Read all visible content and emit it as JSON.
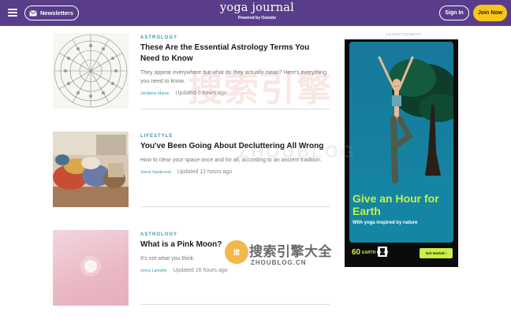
{
  "header": {
    "newsletter_label": "Newsletters",
    "logo_text": "yoga journal",
    "logo_sub": "Powered by Outside",
    "signin_label": "Sign In",
    "join_label": "Join Now",
    "bg_color": "#5a3d8a",
    "join_color": "#f7c716"
  },
  "articles": [
    {
      "category": "ASTROLOGY",
      "title": "These Are the Essential Astrology Terms You Need to Know",
      "dek": "They appear everywhere but what do they actually mean? Here's everything you need to know.",
      "author": "Jordanne Maree",
      "time": "Updated 6 hours ago"
    },
    {
      "category": "LIFESTYLE",
      "title": "You've Been Going About Decluttering All Wrong",
      "dek": "How to clear your space once and for all, according to an ancient tradition.",
      "author": "Sierra Vandervort",
      "time": "Updated 12 hours ago"
    },
    {
      "category": "ASTROLOGY",
      "title": "What is a Pink Moon?",
      "dek": "It's not what you think.",
      "author": "Jenny Lamielle",
      "time": "Updated 16 hours ago"
    }
  ],
  "ad": {
    "label": "ADVERTISEMENT",
    "headline": "Give an Hour for Earth",
    "subtext": "With yoga inspired by nature",
    "logo_number": "60",
    "logo_text": "EARTH HOUR",
    "cta": "Get started ›",
    "accent": "#c8f049"
  },
  "watermark": {
    "big_text": "搜索引擎",
    "big_sub": "ZHOUBLOG",
    "small_text": "搜索引擎大全",
    "small_sub": "ZHOUBLOG.CN",
    "badge": "搜"
  }
}
